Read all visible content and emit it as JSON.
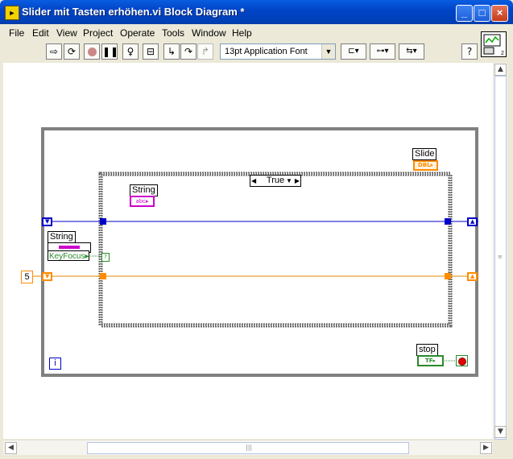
{
  "window": {
    "title": "Slider mit Tasten erhöhen.vi Block Diagram *",
    "icon": "labview-vi-icon",
    "buttons": {
      "minimize": "_",
      "maximize": "□",
      "close": "×"
    }
  },
  "menu": [
    "File",
    "Edit",
    "View",
    "Project",
    "Operate",
    "Tools",
    "Window",
    "Help"
  ],
  "toolbar": {
    "icons": [
      "run-arrow-icon",
      "run-continuously-icon",
      "abort-icon",
      "pause-icon",
      "highlight-execution-icon",
      "retain-wire-values-icon",
      "step-into-icon",
      "step-over-icon",
      "step-out-icon",
      "align-objects-icon",
      "distribute-objects-icon",
      "reorder-icon",
      "help-icon"
    ],
    "font": "13pt Application Font"
  },
  "diagram": {
    "case_selector": "True",
    "nodes": {
      "slide_label": "Slide",
      "slide_type": "DBL",
      "string_case_label": "String",
      "string_case_type": "abc",
      "string_label": "String",
      "keyfocus_label": "KeyFocus",
      "constant_value": "5",
      "stop_label": "stop",
      "stop_type": "TF",
      "iteration_terminal": "i"
    },
    "colors": {
      "loop_border": "#808080",
      "refnum_wire": "#0000c8",
      "numeric_wire": "#e08a00",
      "string": "#cc00cc",
      "boolean": "#2a8a2a",
      "numeric_terminal": "#ff8c00"
    }
  }
}
